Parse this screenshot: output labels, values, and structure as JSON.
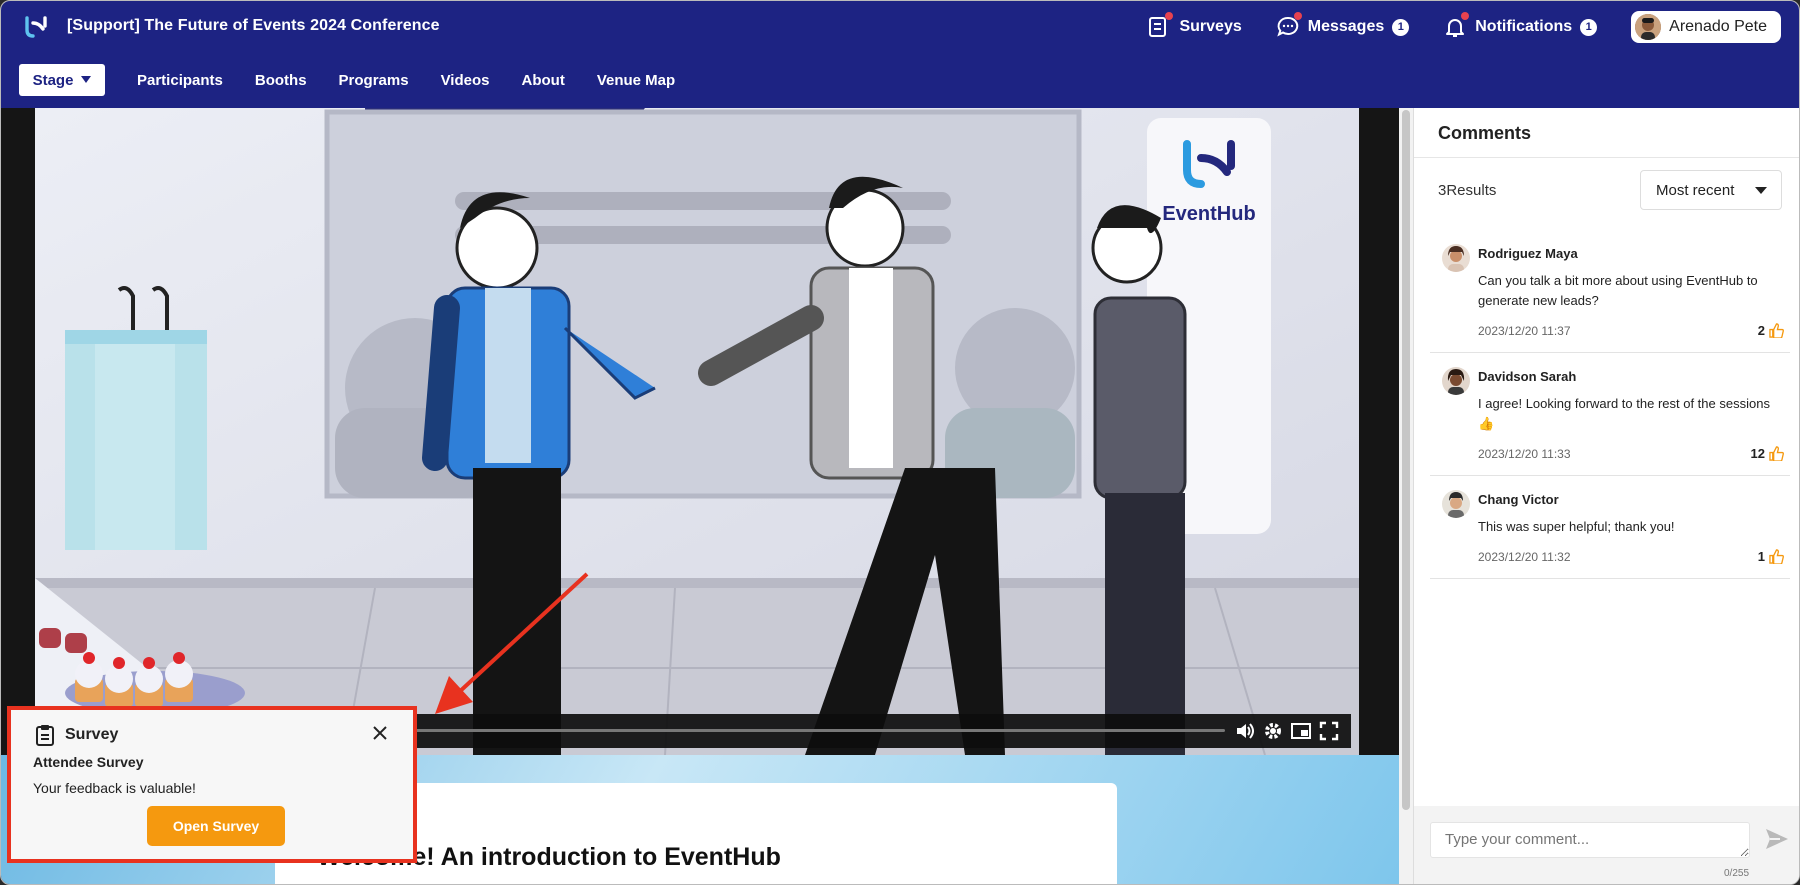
{
  "header": {
    "title": "[Support] The Future of Events 2024 Conference",
    "surveys_label": "Surveys",
    "messages_label": "Messages",
    "messages_count": "1",
    "notifications_label": "Notifications",
    "notifications_count": "1",
    "user_name": "Arenado Pete"
  },
  "nav": {
    "items": [
      "Stage",
      "Participants",
      "Booths",
      "Programs",
      "Videos",
      "About",
      "Venue Map"
    ],
    "active": "Stage"
  },
  "stage": {
    "brand_text": "EventHub",
    "session_title": "Welcome! An introduction to EventHub"
  },
  "comments": {
    "heading": "Comments",
    "result_count": "3Results",
    "sort_value": "Most recent",
    "items": [
      {
        "name": "Rodriguez Maya",
        "text": "Can you talk a bit more about using EventHub to generate new leads?",
        "time": "2023/12/20 11:37",
        "likes": "2"
      },
      {
        "name": "Davidson Sarah",
        "text": "I agree! Looking forward to the rest of the sessions 👍",
        "time": "2023/12/20 11:33",
        "likes": "12"
      },
      {
        "name": "Chang Victor",
        "text": "This was super helpful; thank you!",
        "time": "2023/12/20 11:32",
        "likes": "1"
      }
    ],
    "input_placeholder": "Type your comment...",
    "char_counter": "0/255"
  },
  "survey_popup": {
    "title": "Survey",
    "subtitle": "Attendee Survey",
    "text": "Your feedback is valuable!",
    "button_label": "Open Survey"
  },
  "colors": {
    "header_bg": "#1d2383",
    "accent_orange": "#f5990f",
    "highlight_red": "#e8321f",
    "like_orange": "#f5990f"
  }
}
